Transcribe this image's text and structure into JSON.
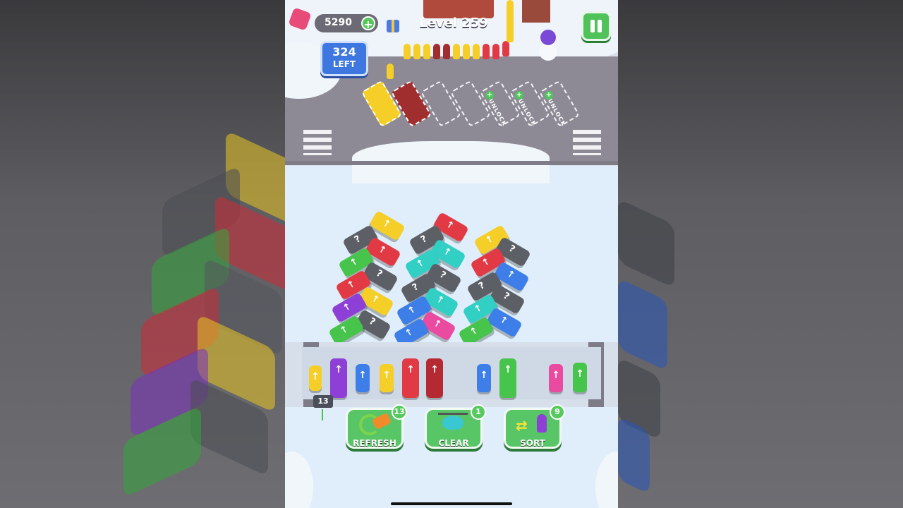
{
  "hud": {
    "coins": "5290",
    "coin_add_label": "+",
    "level": "Level 259",
    "remaining_count": "324",
    "remaining_label": "LEFT"
  },
  "parking": {
    "unlock_labels": [
      "UNLOCK",
      "UNLOCK",
      "UNLOCK"
    ],
    "unlock_plus": "+"
  },
  "queue": {
    "count_badge": "13"
  },
  "powerups": [
    {
      "label": "REFRESH",
      "count": "13"
    },
    {
      "label": "CLEAR",
      "count": "1"
    },
    {
      "label": "SORT",
      "count": "9"
    }
  ],
  "colors": {
    "yellow": "#f5cf28",
    "red": "#e23a45",
    "dark_red": "#b52a32",
    "blue": "#3d7ee8",
    "green": "#47c44b",
    "cyan": "#31cfc4",
    "purple": "#8e3fd6",
    "pink": "#ea4aa0",
    "gray": "#5d5f66"
  },
  "icons": {
    "pause": "pause-icon",
    "gift": "gift-icon",
    "coin_add": "plus-icon",
    "arrow": "↑",
    "hidden": "?"
  }
}
